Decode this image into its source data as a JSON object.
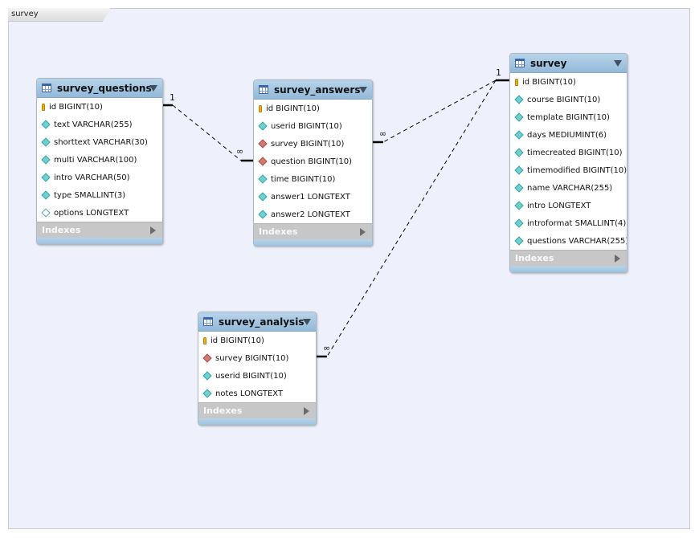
{
  "diagram": {
    "tab_label": "survey"
  },
  "tables": {
    "survey_questions": {
      "title": "survey_questions",
      "indexes_label": "Indexes",
      "columns": [
        {
          "label": "id BIGINT(10)",
          "icon": "primary-key-icon"
        },
        {
          "label": "text VARCHAR(255)",
          "icon": "column-icon"
        },
        {
          "label": "shorttext VARCHAR(30)",
          "icon": "column-icon"
        },
        {
          "label": "multi VARCHAR(100)",
          "icon": "column-icon"
        },
        {
          "label": "intro VARCHAR(50)",
          "icon": "column-icon"
        },
        {
          "label": "type SMALLINT(3)",
          "icon": "column-icon"
        },
        {
          "label": "options LONGTEXT",
          "icon": "nullable-column-icon"
        }
      ]
    },
    "survey_answers": {
      "title": "survey_answers",
      "indexes_label": "Indexes",
      "columns": [
        {
          "label": "id BIGINT(10)",
          "icon": "primary-key-icon"
        },
        {
          "label": "userid BIGINT(10)",
          "icon": "column-icon"
        },
        {
          "label": "survey BIGINT(10)",
          "icon": "foreign-key-icon"
        },
        {
          "label": "question BIGINT(10)",
          "icon": "foreign-key-icon"
        },
        {
          "label": "time BIGINT(10)",
          "icon": "column-icon"
        },
        {
          "label": "answer1 LONGTEXT",
          "icon": "column-icon"
        },
        {
          "label": "answer2 LONGTEXT",
          "icon": "column-icon"
        }
      ]
    },
    "survey": {
      "title": "survey",
      "indexes_label": "Indexes",
      "columns": [
        {
          "label": "id BIGINT(10)",
          "icon": "primary-key-icon"
        },
        {
          "label": "course BIGINT(10)",
          "icon": "column-icon"
        },
        {
          "label": "template BIGINT(10)",
          "icon": "column-icon"
        },
        {
          "label": "days MEDIUMINT(6)",
          "icon": "column-icon"
        },
        {
          "label": "timecreated BIGINT(10)",
          "icon": "column-icon"
        },
        {
          "label": "timemodified BIGINT(10)",
          "icon": "column-icon"
        },
        {
          "label": "name VARCHAR(255)",
          "icon": "column-icon"
        },
        {
          "label": "intro LONGTEXT",
          "icon": "column-icon"
        },
        {
          "label": "introformat SMALLINT(4)",
          "icon": "column-icon"
        },
        {
          "label": "questions VARCHAR(255)",
          "icon": "column-icon"
        }
      ]
    },
    "survey_analysis": {
      "title": "survey_analysis",
      "indexes_label": "Indexes",
      "columns": [
        {
          "label": "id BIGINT(10)",
          "icon": "primary-key-icon"
        },
        {
          "label": "survey BIGINT(10)",
          "icon": "foreign-key-icon"
        },
        {
          "label": "userid BIGINT(10)",
          "icon": "column-icon"
        },
        {
          "label": "notes LONGTEXT",
          "icon": "column-icon"
        }
      ]
    }
  },
  "relationships": [
    {
      "from": "survey_questions",
      "to": "survey_answers",
      "from_cardinality": "1",
      "to_cardinality": "∞"
    },
    {
      "from": "survey",
      "to": "survey_answers",
      "from_cardinality": "1",
      "to_cardinality": "∞"
    },
    {
      "from": "survey",
      "to": "survey_analysis",
      "from_cardinality": "1",
      "to_cardinality": "∞"
    }
  ],
  "colors": {
    "header": "#a3c4e0",
    "canvas": "#eef0fb",
    "indexes": "#c7c7c7",
    "primary_key": "#e8b020",
    "column": "#6fd0d0",
    "foreign_key": "#d07a74"
  }
}
